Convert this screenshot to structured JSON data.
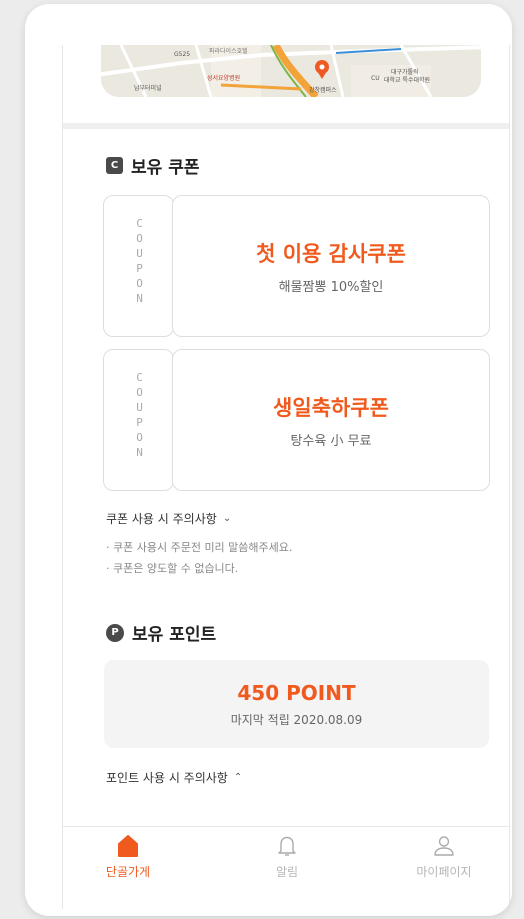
{
  "map": {
    "labels": [
      "G525",
      "파라다이스호텔",
      "남부터미널",
      "성서요양병원",
      "대구가톨릭",
      "대학교 특수대학원",
      "CU",
      "강창캠퍼스"
    ]
  },
  "coupons": {
    "title": "보유 쿠폰",
    "badge": "C",
    "items": [
      {
        "stub": "COUPON",
        "name": "첫 이용 감사쿠폰",
        "desc": "해물짬뽕 10%할인"
      },
      {
        "stub": "COUPON",
        "name": "생일축하쿠폰",
        "desc": "탕수육 小 무료"
      }
    ],
    "notice_toggle": "쿠폰 사용 시 주의사항",
    "notices": [
      "· 쿠폰 사용시 주문전 미리 말씀해주세요.",
      "· 쿠폰은 양도할 수 없습니다."
    ]
  },
  "points": {
    "title": "보유 포인트",
    "badge": "P",
    "value": "450 POINT",
    "last_accrual": "마지막 적립 2020.08.09",
    "notice_toggle": "포인트 사용 시 주의사항"
  },
  "nav": {
    "items": [
      {
        "label": "단골가게",
        "icon": "home-icon",
        "active": true
      },
      {
        "label": "알림",
        "icon": "bell-icon",
        "active": false
      },
      {
        "label": "마이페이지",
        "icon": "user-icon",
        "active": false
      }
    ]
  },
  "colors": {
    "accent": "#f05a1e",
    "inactive": "#b5b5b5"
  }
}
